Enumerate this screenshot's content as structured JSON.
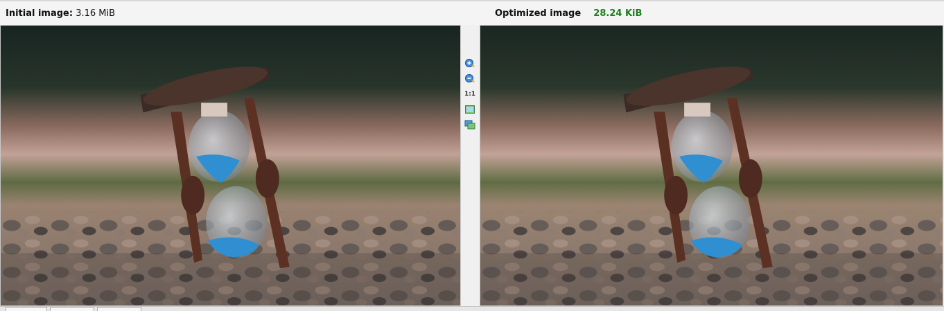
{
  "header": {
    "initial_label": "Initial image:",
    "initial_size": "3.16 MiB",
    "optimized_label": "Optimized image",
    "optimized_size": "28.24 KiB"
  },
  "toolbar": {
    "zoom_in_icon": "zoom-in-icon",
    "zoom_out_icon": "zoom-out-icon",
    "actual_size_label": "1:1",
    "fit_icon": "fit-to-window-icon",
    "compare_icon": "compare-view-icon"
  },
  "colors": {
    "optimized_size": "#1d7d1d",
    "sand_blue": "#2f8fd0"
  }
}
